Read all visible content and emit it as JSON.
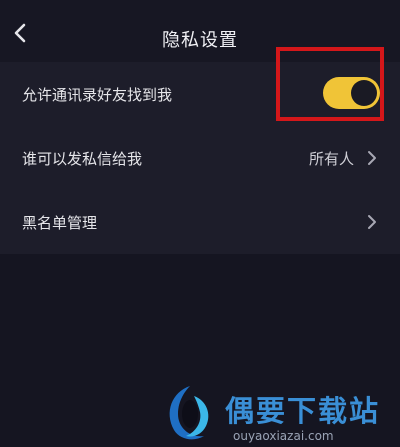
{
  "header": {
    "title": "隐私设置"
  },
  "settings": [
    {
      "label": "允许通讯录好友找到我",
      "toggle_on": true
    },
    {
      "label": "谁可以发私信给我",
      "value": "所有人"
    },
    {
      "label": "黑名单管理"
    }
  ],
  "colors": {
    "background": "#151521",
    "row_background": "#1d1d2a",
    "toggle_on": "#f0c437",
    "highlight": "#d4171a"
  },
  "watermark": {
    "brand": "偶要下载站",
    "url": "ouyaoxiazai.com"
  }
}
